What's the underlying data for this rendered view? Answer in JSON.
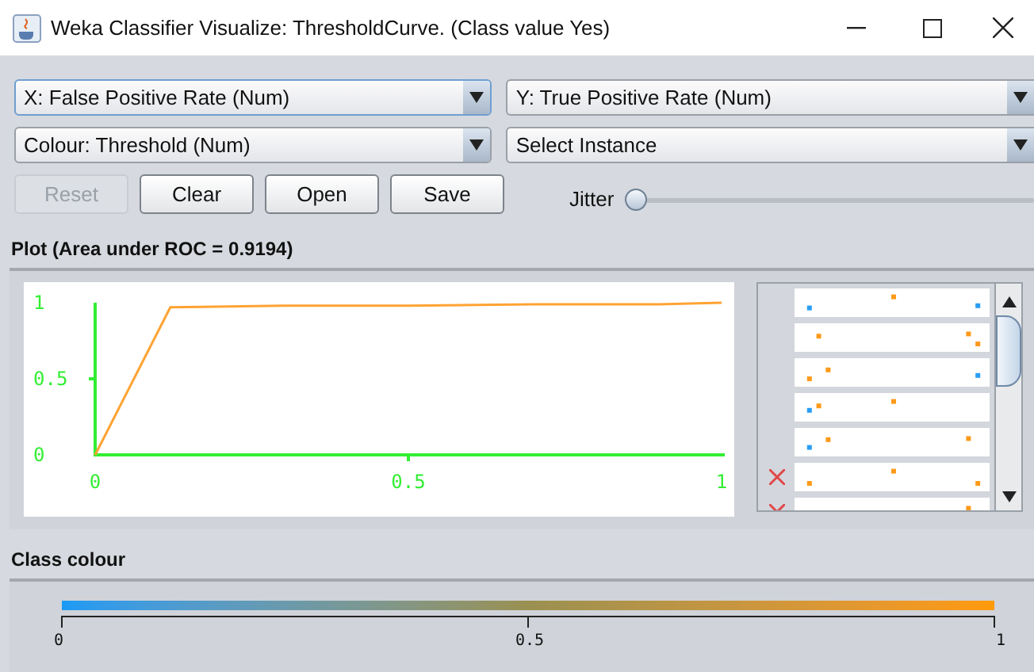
{
  "window": {
    "title": "Weka Classifier Visualize: ThresholdCurve. (Class value Yes)"
  },
  "selectors": [
    {
      "value": "X: False Positive Rate (Num)",
      "focused": true
    },
    {
      "value": "Y: True Positive Rate (Num)",
      "focused": false
    },
    {
      "value": "Colour: Threshold (Num)",
      "focused": false
    },
    {
      "value": "Select Instance",
      "focused": false
    }
  ],
  "buttons": [
    {
      "label": "Reset",
      "disabled": true
    },
    {
      "label": "Clear",
      "disabled": false
    },
    {
      "label": "Open",
      "disabled": false
    },
    {
      "label": "Save",
      "disabled": false
    }
  ],
  "jitter": {
    "label": "Jitter",
    "level": 0
  },
  "plot": {
    "title": "Plot (Area under ROC = 0.9194)",
    "chart_data": {
      "type": "line",
      "x": [
        0,
        0.12,
        0.3,
        0.5,
        0.7,
        0.9,
        1
      ],
      "series": [
        {
          "color": "#ffa333",
          "values": [
            0,
            0.97,
            0.98,
            0.98,
            0.99,
            0.99,
            1
          ]
        }
      ],
      "xlim": [
        0,
        1
      ],
      "ylim": [
        0,
        1
      ],
      "xticks": [
        0,
        0.5,
        1
      ],
      "yticks": [
        0,
        0.5,
        1
      ]
    }
  },
  "instances": [
    {
      "marked": false
    },
    {
      "marked": false
    },
    {
      "marked": false
    },
    {
      "marked": false
    },
    {
      "marked": false
    },
    {
      "marked": true
    },
    {
      "marked": true
    }
  ],
  "class_colour": {
    "title": "Class colour",
    "ticks": [
      "0",
      "0.5",
      "1"
    ]
  }
}
